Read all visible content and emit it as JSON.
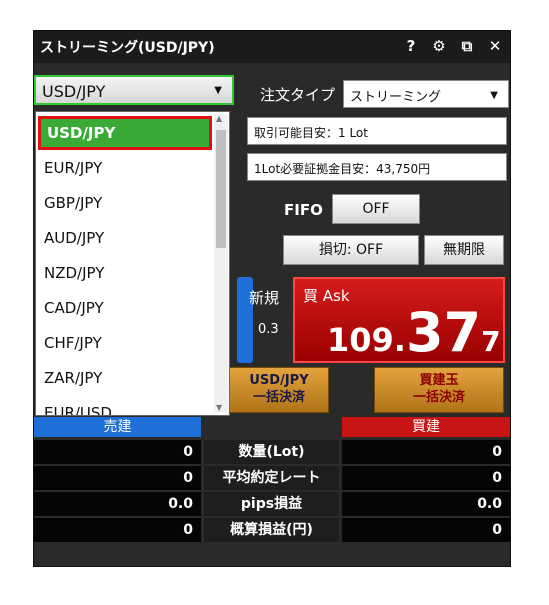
{
  "window": {
    "title": "ストリーミング(USD/JPY)",
    "icons": {
      "help": "?",
      "settings": "⚙",
      "popout": "⧉",
      "close": "✕"
    }
  },
  "symbol": {
    "selected": "USD/JPY",
    "arrow": "▼"
  },
  "order_type": {
    "label": "注文タイプ",
    "value": "ストリーミング",
    "arrow": "▼"
  },
  "info": {
    "tradable": "取引可能目安：1 Lot",
    "margin": "1Lot必要証拠金目安：43,750円"
  },
  "fifo": {
    "label": "FIFO",
    "button": "OFF"
  },
  "stoploss": {
    "button": "損切: OFF",
    "expiry": "無期限"
  },
  "quote": {
    "new_label": "新規",
    "spread": "0.3",
    "ask_label": "買 Ask",
    "ask_big": "109.",
    "ask_pips": "37",
    "ask_frac": "7"
  },
  "bulk": {
    "left_line1": "USD/JPY",
    "left_line2": "一括決済",
    "right_line1": "買建玉",
    "right_line2": "一括決済"
  },
  "positions": {
    "sell_header": "売建",
    "buy_header": "買建",
    "rows": [
      {
        "label": "数量(Lot)",
        "sell": "0",
        "buy": "0"
      },
      {
        "label": "平均約定レート",
        "sell": "0",
        "buy": "0"
      },
      {
        "label": "pips損益",
        "sell": "0.0",
        "buy": "0.0"
      },
      {
        "label": "概算損益(円)",
        "sell": "0",
        "buy": "0"
      }
    ]
  },
  "dropdown": {
    "items": [
      "USD/JPY",
      "EUR/JPY",
      "GBP/JPY",
      "AUD/JPY",
      "NZD/JPY",
      "CAD/JPY",
      "CHF/JPY",
      "ZAR/JPY",
      "EUR/USD"
    ],
    "scroll_up": "▲",
    "scroll_down": "▼"
  },
  "colors": {
    "ask_red": "#c81414",
    "sell_blue": "#1e6fd8",
    "selected_green": "#3aaa36",
    "highlight_red": "#e01010",
    "gold": "#d4902e"
  }
}
